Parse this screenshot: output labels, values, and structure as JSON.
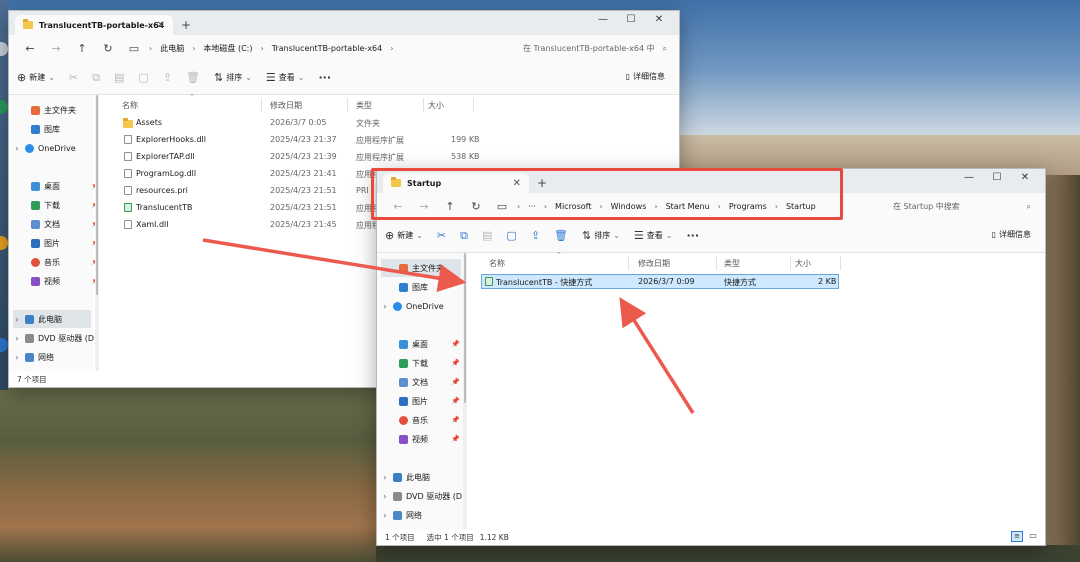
{
  "colors": {
    "accent": "#0067c0",
    "arrow": "#ec5a4e",
    "selection": "#cde8ff"
  },
  "left_window": {
    "tab_title": "TranslucentTB-portable-x64",
    "breadcrumbs": [
      "此电脑",
      "本地磁盘 (C:)",
      "TranslucentTB-portable-x64"
    ],
    "search_placeholder": "在 TranslucentTB-portable-x64 中",
    "commands": {
      "new": "新建",
      "sort": "排序",
      "view": "查看",
      "more": "···",
      "details": "详细信息"
    },
    "sidebar": {
      "home": "主文件夹",
      "gallery": "图库",
      "onedrive": "OneDrive",
      "desktop": "桌面",
      "downloads": "下载",
      "documents": "文档",
      "pictures": "图片",
      "music": "音乐",
      "videos": "视频",
      "this_pc": "此电脑",
      "dvd": "DVD 驱动器 (D",
      "network": "网络"
    },
    "columns": {
      "name": "名称",
      "date": "修改日期",
      "type": "类型",
      "size": "大小"
    },
    "files": [
      {
        "name": "Assets",
        "date": "2026/3/7 0:05",
        "type": "文件夹",
        "size": "",
        "icon": "folder-icon"
      },
      {
        "name": "ExplorerHooks.dll",
        "date": "2025/4/23 21:37",
        "type": "应用程序扩展",
        "size": "199 KB",
        "icon": "dll-icon"
      },
      {
        "name": "ExplorerTAP.dll",
        "date": "2025/4/23 21:39",
        "type": "应用程序扩展",
        "size": "538 KB",
        "icon": "dll-icon"
      },
      {
        "name": "ProgramLog.dll",
        "date": "2025/4/23 21:41",
        "type": "应用程",
        "size": "",
        "icon": "dll-icon"
      },
      {
        "name": "resources.pri",
        "date": "2025/4/23 21:51",
        "type": "PRI",
        "size": "",
        "icon": "file-icon"
      },
      {
        "name": "TranslucentTB",
        "date": "2025/4/23 21:51",
        "type": "应用程",
        "size": "",
        "icon": "app-icon"
      },
      {
        "name": "Xaml.dll",
        "date": "2025/4/23 21:45",
        "type": "应用程",
        "size": "",
        "icon": "dll-icon"
      }
    ],
    "status": "7 个项目"
  },
  "right_window": {
    "tab_title": "Startup",
    "breadcrumbs": [
      "Microsoft",
      "Windows",
      "Start Menu",
      "Programs",
      "Startup"
    ],
    "breadcrumb_more": "···",
    "search_placeholder": "在 Startup 中搜索",
    "commands": {
      "new": "新建",
      "sort": "排序",
      "view": "查看",
      "more": "···",
      "details": "详细信息"
    },
    "sidebar": {
      "home": "主文件夹",
      "gallery": "图库",
      "onedrive": "OneDrive",
      "desktop": "桌面",
      "downloads": "下载",
      "documents": "文档",
      "pictures": "图片",
      "music": "音乐",
      "videos": "视频",
      "this_pc": "此电脑",
      "dvd": "DVD 驱动器 (D",
      "network": "网络"
    },
    "columns": {
      "name": "名称",
      "date": "修改日期",
      "type": "类型",
      "size": "大小"
    },
    "files": [
      {
        "name": "TranslucentTB - 快捷方式",
        "date": "2026/3/7 0:09",
        "type": "快捷方式",
        "size": "2 KB",
        "icon": "shortcut-icon"
      }
    ],
    "status": {
      "count": "1 个项目",
      "selected": "选中 1 个项目",
      "size": "1.12 KB"
    }
  }
}
